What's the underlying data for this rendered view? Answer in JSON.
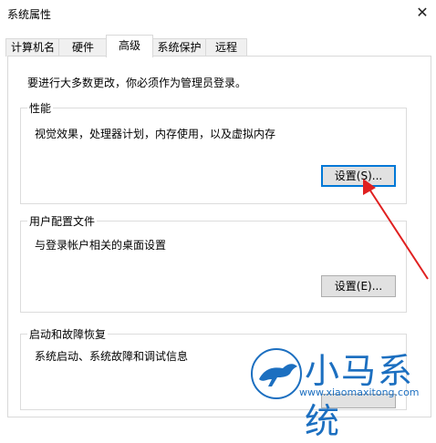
{
  "window": {
    "title": "系统属性",
    "close_glyph": "✕"
  },
  "tabs": [
    {
      "label": "计算机名",
      "active": false
    },
    {
      "label": "硬件",
      "active": false
    },
    {
      "label": "高级",
      "active": true
    },
    {
      "label": "系统保护",
      "active": false
    },
    {
      "label": "远程",
      "active": false
    }
  ],
  "admin_note": "要进行大多数更改，你必须作为管理员登录。",
  "performance": {
    "legend": "性能",
    "desc": "视觉效果，处理器计划，内存使用，以及虚拟内存",
    "button": "设置(S)..."
  },
  "user_profiles": {
    "legend": "用户配置文件",
    "desc": "与登录帐户相关的桌面设置",
    "button": "设置(E)..."
  },
  "startup": {
    "legend": "启动和故障恢复",
    "desc": "系统启动、系统故障和调试信息"
  },
  "annotation_arrow_color": "#e02020",
  "watermark": {
    "name": "小马系统",
    "url": "www.xiaomaxitong.com",
    "color": "#1c6fc0"
  }
}
